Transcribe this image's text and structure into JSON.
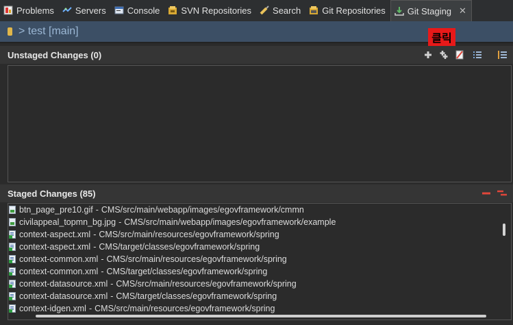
{
  "tabs": [
    {
      "label": "Problems",
      "icon": "problems-icon",
      "active": false
    },
    {
      "label": "Servers",
      "icon": "servers-icon",
      "active": false
    },
    {
      "label": "Console",
      "icon": "console-icon",
      "active": false
    },
    {
      "label": "SVN Repositories",
      "icon": "svn-repository-icon",
      "active": false
    },
    {
      "label": "Search",
      "icon": "search-icon",
      "active": false
    },
    {
      "label": "Git Repositories",
      "icon": "git-repository-icon",
      "active": false
    },
    {
      "label": "Git Staging",
      "icon": "git-staging-icon",
      "active": true
    }
  ],
  "repo": {
    "label": "> test [main]"
  },
  "unstaged": {
    "title": "Unstaged Changes (0)",
    "files": []
  },
  "annotation": {
    "text": "클릭",
    "color": "#e81919"
  },
  "staged": {
    "title": "Staged Changes (85)",
    "files": [
      {
        "name": "btn_page_pre10.gif",
        "path": "CMS/src/main/webapp/images/egovframework/cmmn",
        "type": "gif"
      },
      {
        "name": "civilappeal_topmn_bg.jpg",
        "path": "CMS/src/main/webapp/images/egovframework/example",
        "type": "gif"
      },
      {
        "name": "context-aspect.xml",
        "path": "CMS/src/main/resources/egovframework/spring",
        "type": "xml"
      },
      {
        "name": "context-aspect.xml",
        "path": "CMS/target/classes/egovframework/spring",
        "type": "xml"
      },
      {
        "name": "context-common.xml",
        "path": "CMS/src/main/resources/egovframework/spring",
        "type": "xml"
      },
      {
        "name": "context-common.xml",
        "path": "CMS/target/classes/egovframework/spring",
        "type": "xml"
      },
      {
        "name": "context-datasource.xml",
        "path": "CMS/src/main/resources/egovframework/spring",
        "type": "xml"
      },
      {
        "name": "context-datasource.xml",
        "path": "CMS/target/classes/egovframework/spring",
        "type": "xml"
      },
      {
        "name": "context-idgen.xml",
        "path": "CMS/src/main/resources/egovframework/spring",
        "type": "xml"
      }
    ]
  },
  "colors": {
    "repo_bar": "#3c4f65",
    "minus_red": "#e0463a",
    "add_icon": "#d0d0d0"
  }
}
